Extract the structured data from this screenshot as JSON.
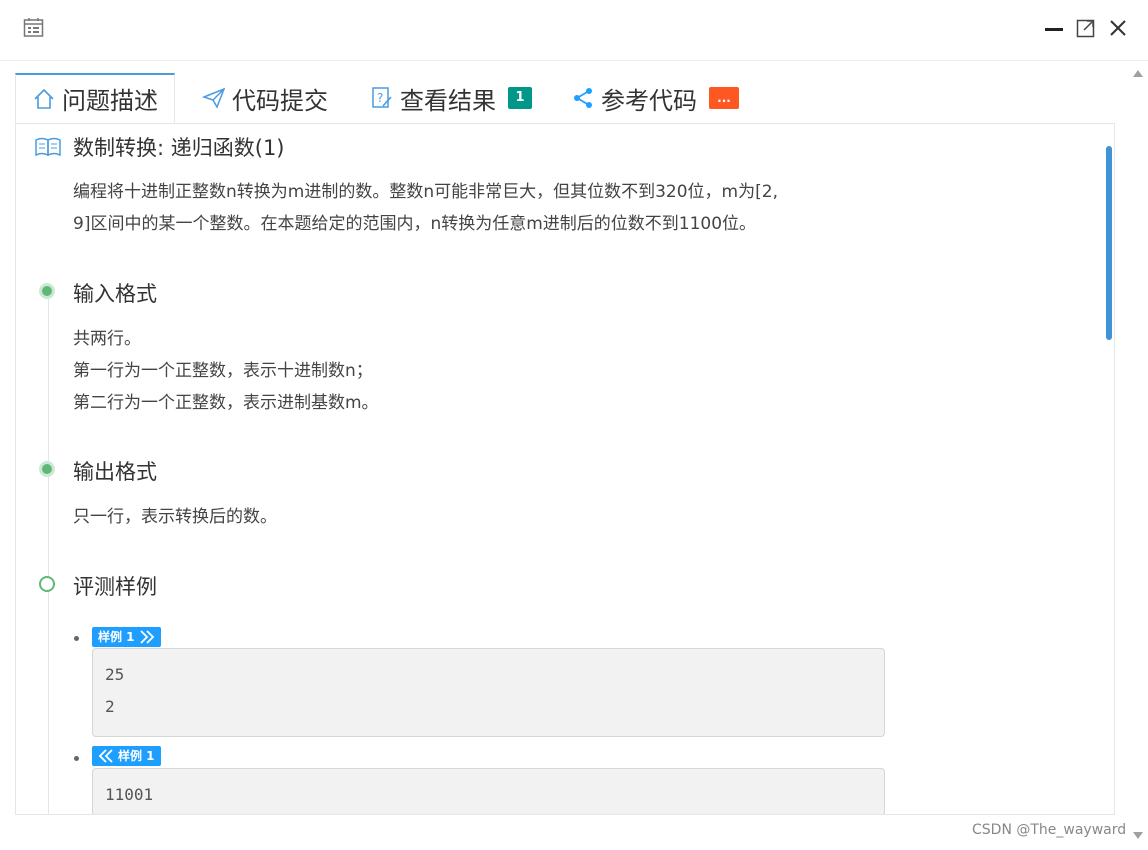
{
  "window": {
    "app_icon": "calendar-icon",
    "minimize_icon": "minimize-icon",
    "maximize_icon": "maximize-icon",
    "close_icon": "close-icon"
  },
  "tabs": [
    {
      "label": "问题描述",
      "icon": "home-icon",
      "active": true
    },
    {
      "label": "代码提交",
      "icon": "paper-plane-icon"
    },
    {
      "label": "查看结果",
      "icon": "edit-question-icon",
      "badge": "1",
      "badge_color": "#009688"
    },
    {
      "label": "参考代码",
      "icon": "share-icon",
      "badge": "...",
      "badge_color": "#ff5722"
    }
  ],
  "problem": {
    "title": "数制转换: 递归函数(1)",
    "description_line1": "编程将十进制正整数n转换为m进制的数。整数n可能非常巨大，但其位数不到320位，m为[2,",
    "description_line2": "9]区间中的某一个整数。在本题给定的范围内，n转换为任意m进制后的位数不到1100位。"
  },
  "input_format": {
    "title": "输入格式",
    "lines": [
      "共两行。",
      "第一行为一个正整数，表示十进制数n；",
      "第二行为一个正整数，表示进制基数m。"
    ]
  },
  "output_format": {
    "title": "输出格式",
    "lines": [
      "只一行，表示转换后的数。"
    ]
  },
  "samples": {
    "title": "评测样例",
    "input_tag": "样例 1",
    "input_lines": [
      "25",
      "2"
    ],
    "output_tag": "样例 1",
    "output_lines": [
      "11001"
    ]
  },
  "watermark": "CSDN @The_wayward",
  "colors": {
    "accent": "#4a9be0",
    "timeline_green": "#5fb878",
    "tag_blue": "#1e9fff"
  }
}
